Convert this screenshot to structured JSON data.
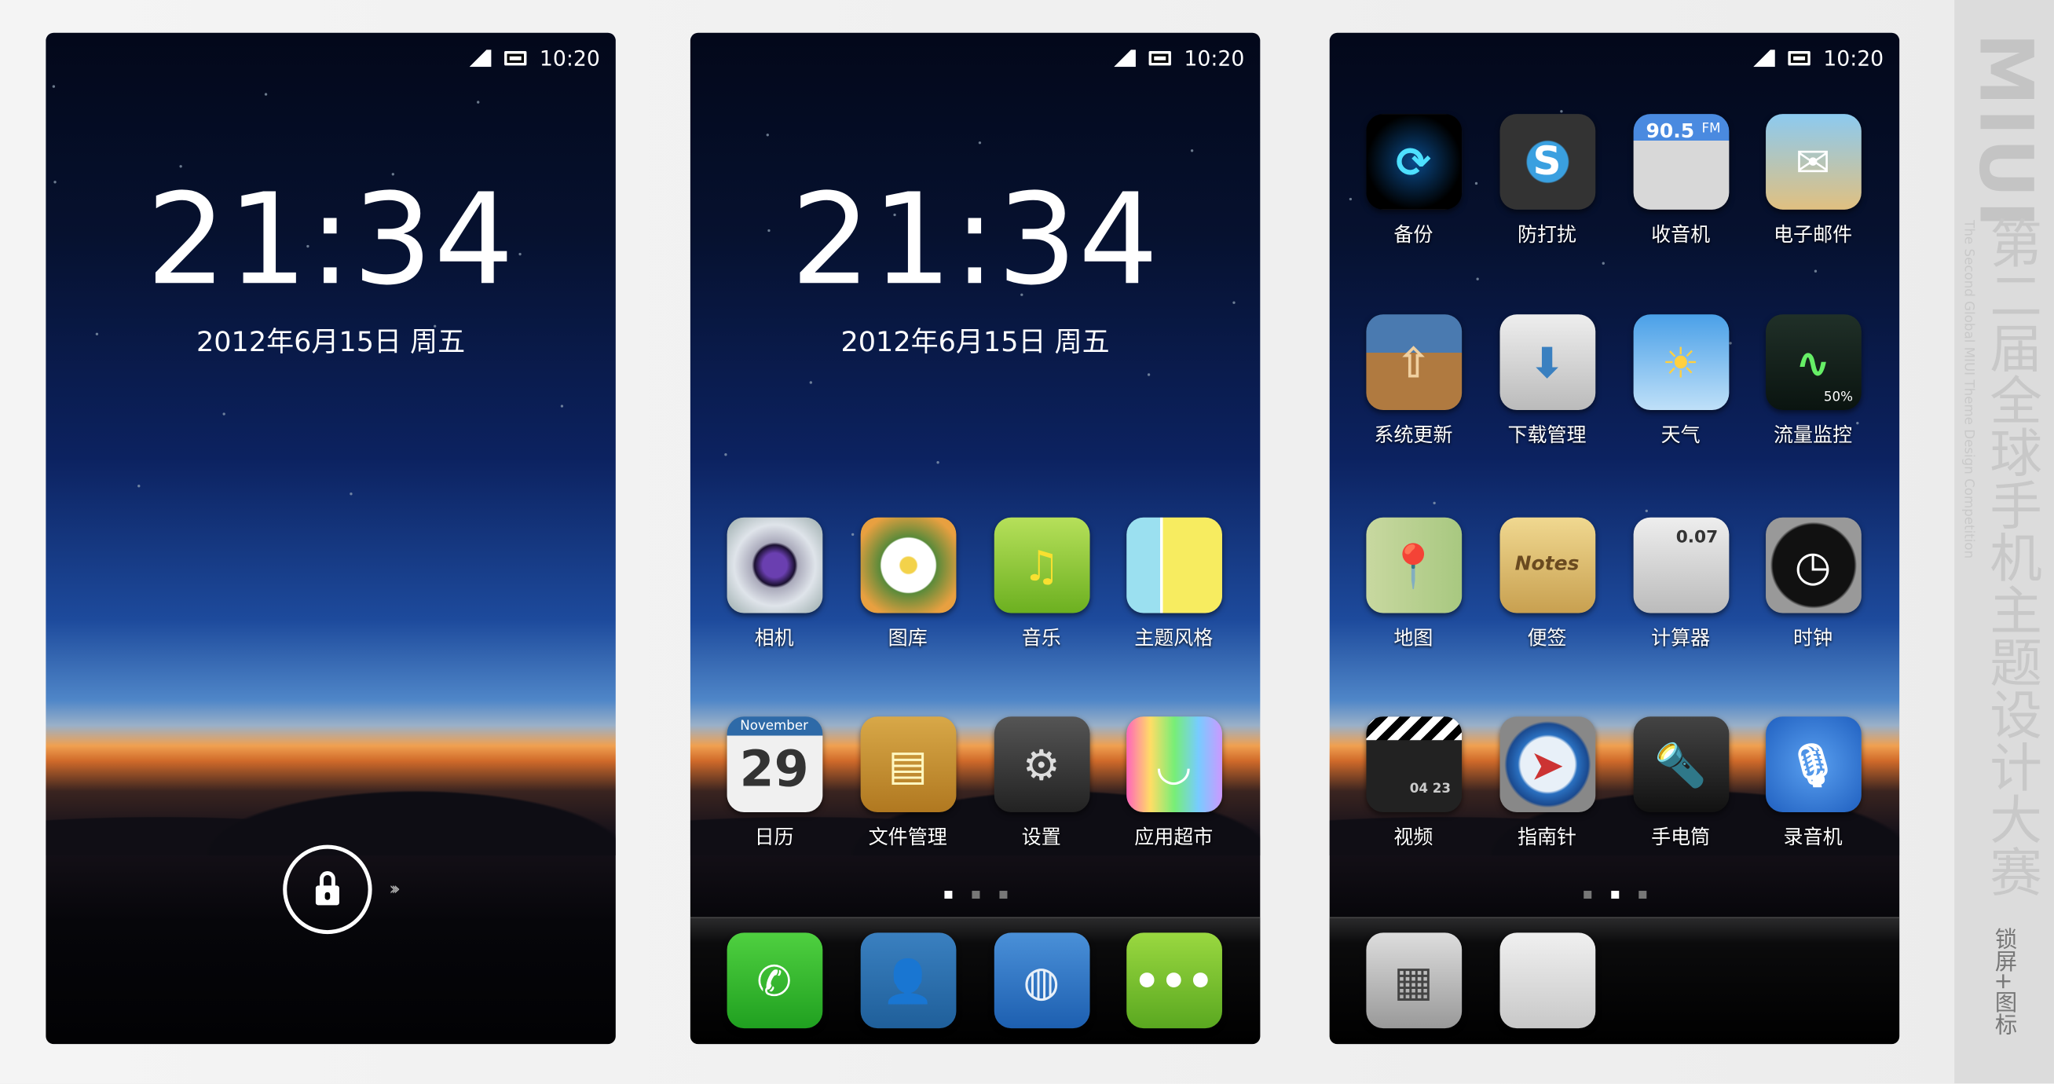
{
  "status_bar": {
    "time": "10:20",
    "signal_icon": "signal-icon",
    "battery_icon": "battery-icon"
  },
  "lockscreen": {
    "clock": "21:34",
    "date": "2012年6月15日 周五",
    "unlock_icon": "lock-icon",
    "arrows": "›››"
  },
  "home1": {
    "clock": "21:34",
    "date": "2012年6月15日 周五",
    "apps": [
      {
        "label": "相机",
        "icon": "camera-icon"
      },
      {
        "label": "图库",
        "icon": "gallery-icon"
      },
      {
        "label": "音乐",
        "icon": "music-icon"
      },
      {
        "label": "主题风格",
        "icon": "theme-icon"
      },
      {
        "label": "日历",
        "icon": "calendar-icon",
        "icon_text": "29",
        "icon_subtext": "November"
      },
      {
        "label": "文件管理",
        "icon": "file-manager-icon"
      },
      {
        "label": "设置",
        "icon": "settings-icon"
      },
      {
        "label": "应用超市",
        "icon": "app-market-icon"
      }
    ],
    "dock": [
      {
        "icon": "phone-icon"
      },
      {
        "icon": "contacts-icon"
      },
      {
        "icon": "browser-icon"
      },
      {
        "icon": "messages-icon"
      }
    ],
    "active_page": 1,
    "page_count": 3
  },
  "home2": {
    "apps": [
      {
        "label": "备份",
        "icon": "backup-icon"
      },
      {
        "label": "防打扰",
        "icon": "firewall-icon",
        "icon_text": "S"
      },
      {
        "label": "收音机",
        "icon": "radio-icon",
        "icon_text": "90.5",
        "icon_subtext": "FM"
      },
      {
        "label": "电子邮件",
        "icon": "email-icon"
      },
      {
        "label": "系统更新",
        "icon": "system-update-icon"
      },
      {
        "label": "下载管理",
        "icon": "download-icon"
      },
      {
        "label": "天气",
        "icon": "weather-icon"
      },
      {
        "label": "流量监控",
        "icon": "traffic-monitor-icon",
        "icon_subtext": "50%"
      },
      {
        "label": "地图",
        "icon": "map-icon"
      },
      {
        "label": "便签",
        "icon": "notes-icon",
        "icon_text": "Notes"
      },
      {
        "label": "计算器",
        "icon": "calculator-icon",
        "icon_text": "0.07"
      },
      {
        "label": "时钟",
        "icon": "clock-icon"
      },
      {
        "label": "视频",
        "icon": "video-icon",
        "icon_text": "04 23"
      },
      {
        "label": "指南针",
        "icon": "compass-icon"
      },
      {
        "label": "手电筒",
        "icon": "flashlight-icon"
      },
      {
        "label": "录音机",
        "icon": "recorder-icon"
      }
    ],
    "dock": [
      {
        "icon": "folder-icon"
      },
      {
        "icon": "empty-slot-icon"
      }
    ],
    "active_page": 2,
    "page_count": 3
  },
  "sidebar": {
    "logo": "MIUI",
    "subtitle": "The Second Global MIUI Theme Design Competition",
    "title": "第二届全球手机主题设计大赛",
    "tag": "锁屏+图标"
  }
}
